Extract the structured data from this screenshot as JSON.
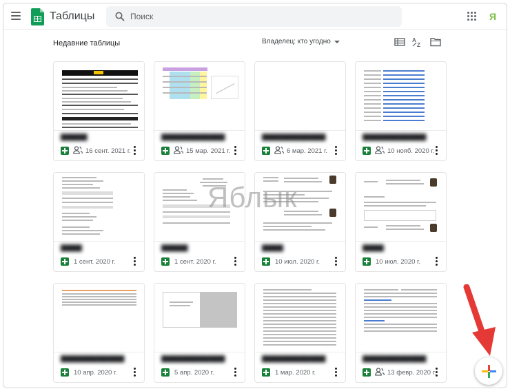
{
  "header": {
    "title": "Таблицы",
    "search_placeholder": "Поиск",
    "avatar_letter": "Я"
  },
  "toolbar": {
    "section_title": "Недавние таблицы",
    "owner_filter": "Владелец: кто угодно"
  },
  "watermark": "Яблык",
  "colors": {
    "sheets_green": "#188038",
    "arrow_red": "#e53935",
    "fab_plus": [
      "#ea4335",
      "#fbbc05",
      "#34a853",
      "#4285f4"
    ]
  },
  "cards": [
    {
      "date": "16 сент. 2021 г.",
      "shared": true
    },
    {
      "date": "15 мар. 2021 г.",
      "shared": true
    },
    {
      "date": "6 мар. 2021 г.",
      "shared": true
    },
    {
      "date": "10 нояб. 2020 г.",
      "shared": true
    },
    {
      "date": "1 сент. 2020 г.",
      "shared": false
    },
    {
      "date": "1 сент. 2020 г.",
      "shared": false
    },
    {
      "date": "10 июл. 2020 г.",
      "shared": false
    },
    {
      "date": "10 июл. 2020 г.",
      "shared": false
    },
    {
      "date": "10 апр. 2020 г.",
      "shared": false
    },
    {
      "date": "5 апр. 2020 г.",
      "shared": false
    },
    {
      "date": "1 мар. 2020 г.",
      "shared": false
    },
    {
      "date": "13 февр. 2020 г.",
      "shared": true
    }
  ]
}
